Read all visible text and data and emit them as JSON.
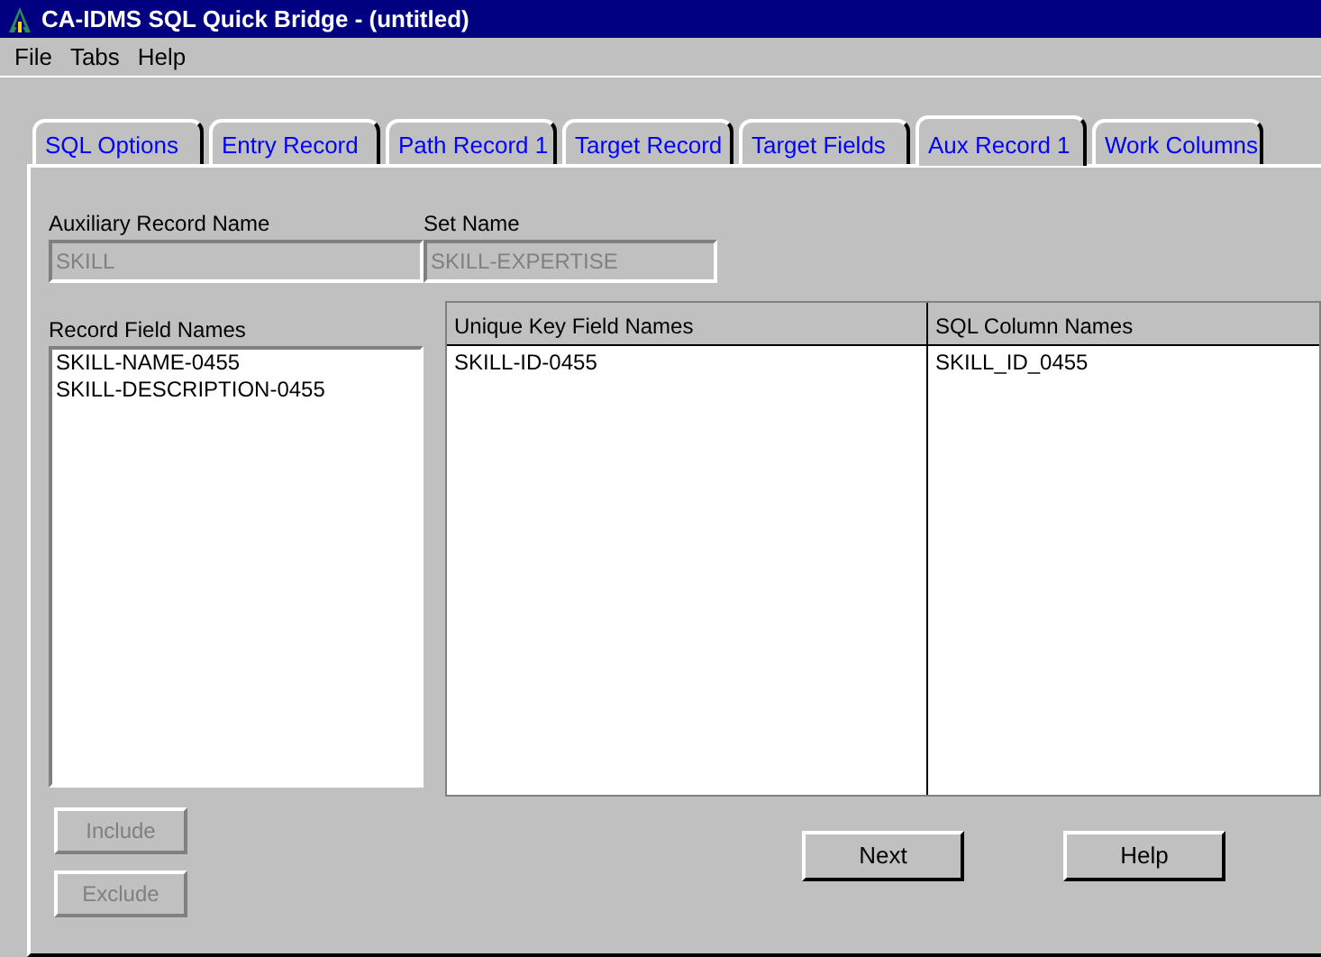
{
  "window": {
    "title": "CA-IDMS SQL Quick Bridge - (untitled)"
  },
  "menu": [
    "File",
    "Tabs",
    "Help"
  ],
  "tabs": [
    {
      "label": "SQL Options",
      "selected": false
    },
    {
      "label": "Entry Record",
      "selected": false
    },
    {
      "label": "Path Record 1",
      "selected": false
    },
    {
      "label": "Target Record",
      "selected": false
    },
    {
      "label": "Target Fields",
      "selected": false
    },
    {
      "label": "Aux Record 1",
      "selected": true
    },
    {
      "label": "Work Columns",
      "selected": false
    }
  ],
  "auxiliary_record_name": {
    "label": "Auxiliary Record Name",
    "value": "SKILL",
    "disabled": true
  },
  "set_name": {
    "label": "Set Name",
    "value": "SKILL-EXPERTISE",
    "disabled": true
  },
  "record_field_names": {
    "label": "Record Field Names",
    "items": [
      "SKILL-NAME-0455",
      "SKILL-DESCRIPTION-0455"
    ]
  },
  "table": {
    "columns": [
      "Unique Key Field Names",
      "SQL Column Names"
    ],
    "rows": [
      [
        "SKILL-ID-0455",
        "SKILL_ID_0455"
      ]
    ]
  },
  "list_buttons": [
    {
      "label": "Include",
      "disabled": true
    },
    {
      "label": "Exclude",
      "disabled": true
    }
  ],
  "buttons": [
    {
      "label": "Next",
      "disabled": false
    },
    {
      "label": "Help",
      "disabled": false
    }
  ]
}
